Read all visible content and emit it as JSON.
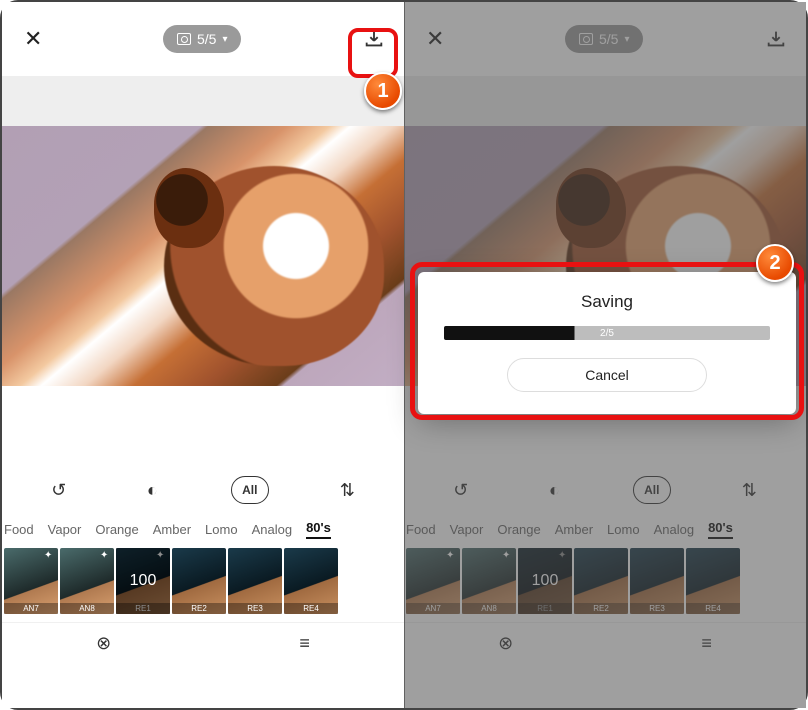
{
  "left": {
    "top": {
      "count_label": "5/5"
    },
    "iconrow": {
      "all_label": "All"
    },
    "categories": [
      "Food",
      "Vapor",
      "Orange",
      "Amber",
      "Lomo",
      "Analog",
      "80's"
    ],
    "active_category_index": 6,
    "thumbs": [
      {
        "label": "AN7",
        "kind": "an",
        "star": true
      },
      {
        "label": "AN8",
        "kind": "an",
        "star": true
      },
      {
        "label": "RE1",
        "kind": "re",
        "star": true,
        "selected": true,
        "value": "100"
      },
      {
        "label": "RE2",
        "kind": "re"
      },
      {
        "label": "RE3",
        "kind": "re"
      },
      {
        "label": "RE4",
        "kind": "re"
      }
    ]
  },
  "right": {
    "top": {
      "count_label": "5/5"
    },
    "iconrow": {
      "all_label": "All"
    },
    "categories": [
      "Food",
      "Vapor",
      "Orange",
      "Amber",
      "Lomo",
      "Analog",
      "80's"
    ],
    "active_category_index": 6,
    "thumbs": [
      {
        "label": "AN7",
        "kind": "an",
        "star": true
      },
      {
        "label": "AN8",
        "kind": "an",
        "star": true
      },
      {
        "label": "RE1",
        "kind": "re",
        "star": true,
        "selected": true,
        "value": "100"
      },
      {
        "label": "RE2",
        "kind": "re"
      },
      {
        "label": "RE3",
        "kind": "re"
      },
      {
        "label": "RE4",
        "kind": "re"
      }
    ],
    "modal": {
      "title": "Saving",
      "progress_label": "2/5",
      "progress_pct": 40,
      "cancel_label": "Cancel"
    }
  },
  "callouts": {
    "one": "1",
    "two": "2"
  }
}
